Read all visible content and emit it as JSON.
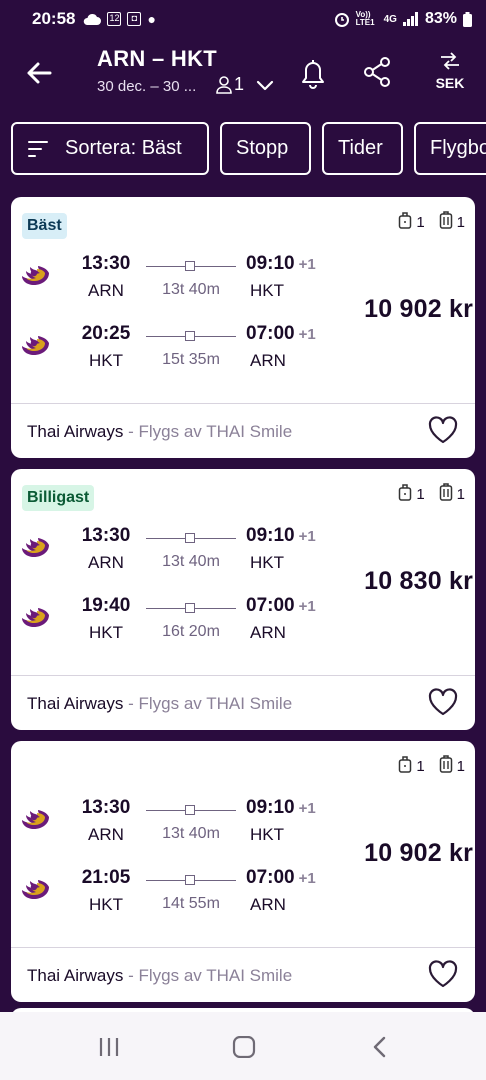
{
  "status_bar": {
    "time": "20:58",
    "battery": "83%",
    "network": "4G",
    "volte": "Vo)) LTE1"
  },
  "header": {
    "route": "ARN – HKT",
    "dates": "30 dec. – 30 ...",
    "passengers": "1",
    "currency": "SEK"
  },
  "filters": [
    {
      "label": "Sortera: Bäst"
    },
    {
      "label": "Stopp"
    },
    {
      "label": "Tider"
    },
    {
      "label": "Flygbo"
    }
  ],
  "results": [
    {
      "badge": "Bäst",
      "badge_color": "#d8eef7",
      "cabin_bags": "1",
      "checked_bags": "1",
      "price": "10 902 kr",
      "airline": "Thai Airways",
      "operated_by": "- Flygs av THAI Smile",
      "legs": [
        {
          "dep_time": "13:30",
          "from": "ARN",
          "duration": "13t 40m",
          "arr_time": "09:10",
          "day_offset": "+1",
          "to": "HKT"
        },
        {
          "dep_time": "20:25",
          "from": "HKT",
          "duration": "15t 35m",
          "arr_time": "07:00",
          "day_offset": "+1",
          "to": "ARN"
        }
      ]
    },
    {
      "badge": "Billigast",
      "badge_color": "#d7f5e6",
      "cabin_bags": "1",
      "checked_bags": "1",
      "price": "10 830 kr",
      "airline": "Thai Airways",
      "operated_by": "- Flygs av THAI Smile",
      "legs": [
        {
          "dep_time": "13:30",
          "from": "ARN",
          "duration": "13t 40m",
          "arr_time": "09:10",
          "day_offset": "+1",
          "to": "HKT"
        },
        {
          "dep_time": "19:40",
          "from": "HKT",
          "duration": "16t 20m",
          "arr_time": "07:00",
          "day_offset": "+1",
          "to": "ARN"
        }
      ]
    },
    {
      "badge": "",
      "badge_color": "",
      "cabin_bags": "1",
      "checked_bags": "1",
      "price": "10 902 kr",
      "airline": "Thai Airways",
      "operated_by": "- Flygs av THAI Smile",
      "legs": [
        {
          "dep_time": "13:30",
          "from": "ARN",
          "duration": "13t 40m",
          "arr_time": "09:10",
          "day_offset": "+1",
          "to": "HKT"
        },
        {
          "dep_time": "21:05",
          "from": "HKT",
          "duration": "14t 55m",
          "arr_time": "07:00",
          "day_offset": "+1",
          "to": "ARN"
        }
      ]
    }
  ],
  "colors": {
    "brand_dark": "#2a0c3e",
    "badge_best": "#d8eef7",
    "badge_cheapest": "#d7f5e6",
    "thai_purple": "#6b1b7a",
    "thai_gold": "#d9a21c"
  }
}
